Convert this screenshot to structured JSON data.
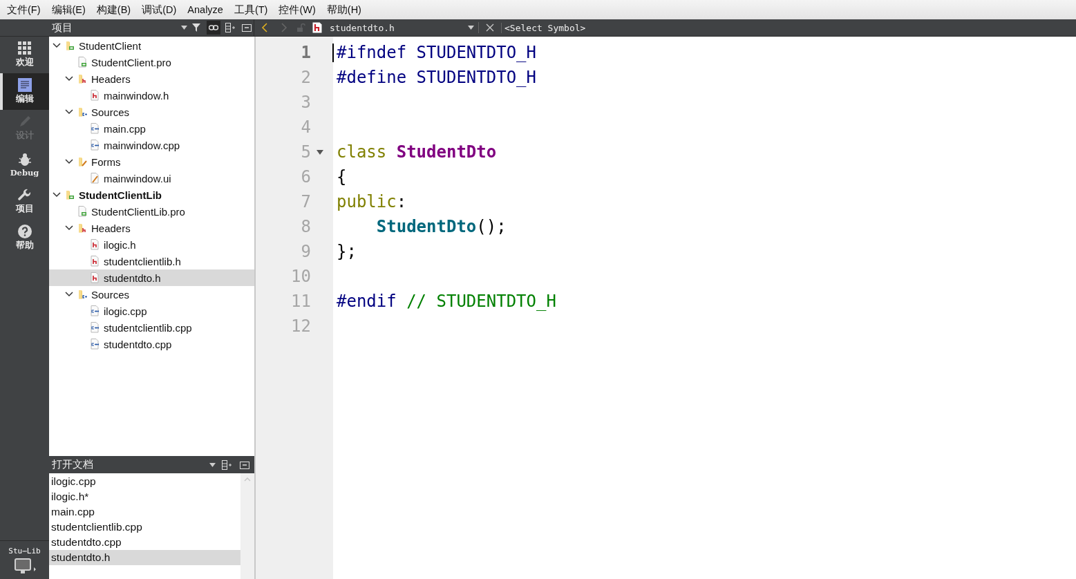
{
  "menu": [
    "文件(F)",
    "编辑(E)",
    "构建(B)",
    "调试(D)",
    "Analyze",
    "工具(T)",
    "控件(W)",
    "帮助(H)"
  ],
  "project_pane": {
    "title": "项目"
  },
  "editor_toolbar": {
    "file": "studentdto.h",
    "symbol": "<Select Symbol>",
    "back_enabled": true,
    "forward_enabled": false
  },
  "modes": [
    {
      "kind": "welcome",
      "label": "欢迎",
      "selected": false,
      "disabled": false
    },
    {
      "kind": "edit",
      "label": "编辑",
      "selected": true,
      "disabled": false
    },
    {
      "kind": "design",
      "label": "设计",
      "selected": false,
      "disabled": true
    },
    {
      "kind": "debug",
      "label": "Debug",
      "selected": false,
      "disabled": false
    },
    {
      "kind": "projects",
      "label": "项目",
      "selected": false,
      "disabled": false
    },
    {
      "kind": "help",
      "label": "帮助",
      "selected": false,
      "disabled": false
    }
  ],
  "tree": [
    {
      "label": "StudentClient",
      "kind": "project",
      "active": false,
      "selected": false,
      "expanded": true,
      "children": [
        {
          "label": "StudentClient.pro",
          "kind": "pro",
          "active": false,
          "selected": false
        },
        {
          "label": "Headers",
          "kind": "headers",
          "active": false,
          "selected": false,
          "expanded": true,
          "children": [
            {
              "label": "mainwindow.h",
              "kind": "h",
              "active": false,
              "selected": false
            }
          ]
        },
        {
          "label": "Sources",
          "kind": "sources",
          "active": false,
          "selected": false,
          "expanded": true,
          "children": [
            {
              "label": "main.cpp",
              "kind": "cpp",
              "active": false,
              "selected": false
            },
            {
              "label": "mainwindow.cpp",
              "kind": "cpp",
              "active": false,
              "selected": false
            }
          ]
        },
        {
          "label": "Forms",
          "kind": "forms",
          "active": false,
          "selected": false,
          "expanded": true,
          "children": [
            {
              "label": "mainwindow.ui",
              "kind": "ui",
              "active": false,
              "selected": false
            }
          ]
        }
      ]
    },
    {
      "label": "StudentClientLib",
      "kind": "project",
      "active": true,
      "selected": false,
      "expanded": true,
      "children": [
        {
          "label": "StudentClientLib.pro",
          "kind": "pro",
          "active": false,
          "selected": false
        },
        {
          "label": "Headers",
          "kind": "headers",
          "active": false,
          "selected": false,
          "expanded": true,
          "children": [
            {
              "label": "ilogic.h",
              "kind": "h",
              "active": false,
              "selected": false
            },
            {
              "label": "studentclientlib.h",
              "kind": "h",
              "active": false,
              "selected": false
            },
            {
              "label": "studentdto.h",
              "kind": "h",
              "active": false,
              "selected": true
            }
          ]
        },
        {
          "label": "Sources",
          "kind": "sources",
          "active": false,
          "selected": false,
          "expanded": true,
          "children": [
            {
              "label": "ilogic.cpp",
              "kind": "cpp",
              "active": false,
              "selected": false
            },
            {
              "label": "studentclientlib.cpp",
              "kind": "cpp",
              "active": false,
              "selected": false
            },
            {
              "label": "studentdto.cpp",
              "kind": "cpp",
              "active": false,
              "selected": false
            }
          ]
        }
      ]
    }
  ],
  "open_documents": {
    "title": "打开文档",
    "items": [
      {
        "label": "ilogic.cpp",
        "selected": false
      },
      {
        "label": "ilogic.h*",
        "selected": false
      },
      {
        "label": "main.cpp",
        "selected": false
      },
      {
        "label": "studentclientlib.cpp",
        "selected": false
      },
      {
        "label": "studentdto.cpp",
        "selected": false
      },
      {
        "label": "studentdto.h",
        "selected": true
      }
    ]
  },
  "kit_selector": {
    "label": "Stu⋯Lib"
  },
  "code": {
    "lines": [
      {
        "number": "1",
        "current": true,
        "cursor": true,
        "foldable": false,
        "tokens": [
          {
            "kind": "preproc",
            "text": "#ifndef STUDENTDTO_H"
          }
        ]
      },
      {
        "number": "2",
        "current": false,
        "cursor": false,
        "foldable": false,
        "tokens": [
          {
            "kind": "preproc",
            "text": "#define STUDENTDTO_H"
          }
        ]
      },
      {
        "number": "3",
        "current": false,
        "cursor": false,
        "foldable": false
      },
      {
        "number": "4",
        "current": false,
        "cursor": false,
        "foldable": false
      },
      {
        "number": "5",
        "current": false,
        "cursor": false,
        "foldable": true,
        "tokens": [
          {
            "kind": "keyword",
            "text": "class "
          },
          {
            "kind": "type",
            "text": "StudentDto"
          }
        ]
      },
      {
        "number": "6",
        "current": false,
        "cursor": false,
        "foldable": false,
        "tokens": [
          {
            "kind": "plain",
            "text": "{"
          }
        ]
      },
      {
        "number": "7",
        "current": false,
        "cursor": false,
        "foldable": false,
        "tokens": [
          {
            "kind": "keyword",
            "text": "public"
          },
          {
            "kind": "plain",
            "text": ":"
          }
        ]
      },
      {
        "number": "8",
        "current": false,
        "cursor": false,
        "foldable": false,
        "tokens": [
          {
            "kind": "function",
            "text": "    StudentDto"
          },
          {
            "kind": "plain",
            "text": "();"
          }
        ]
      },
      {
        "number": "9",
        "current": false,
        "cursor": false,
        "foldable": false,
        "tokens": [
          {
            "kind": "plain",
            "text": "};"
          }
        ]
      },
      {
        "number": "10",
        "current": false,
        "cursor": false,
        "foldable": false
      },
      {
        "number": "11",
        "current": false,
        "cursor": false,
        "foldable": false,
        "tokens": [
          {
            "kind": "preproc",
            "text": "#endif "
          },
          {
            "kind": "comment",
            "text": "// STUDENTDTO_H"
          }
        ]
      },
      {
        "number": "12",
        "current": false,
        "cursor": false,
        "foldable": false
      }
    ]
  }
}
